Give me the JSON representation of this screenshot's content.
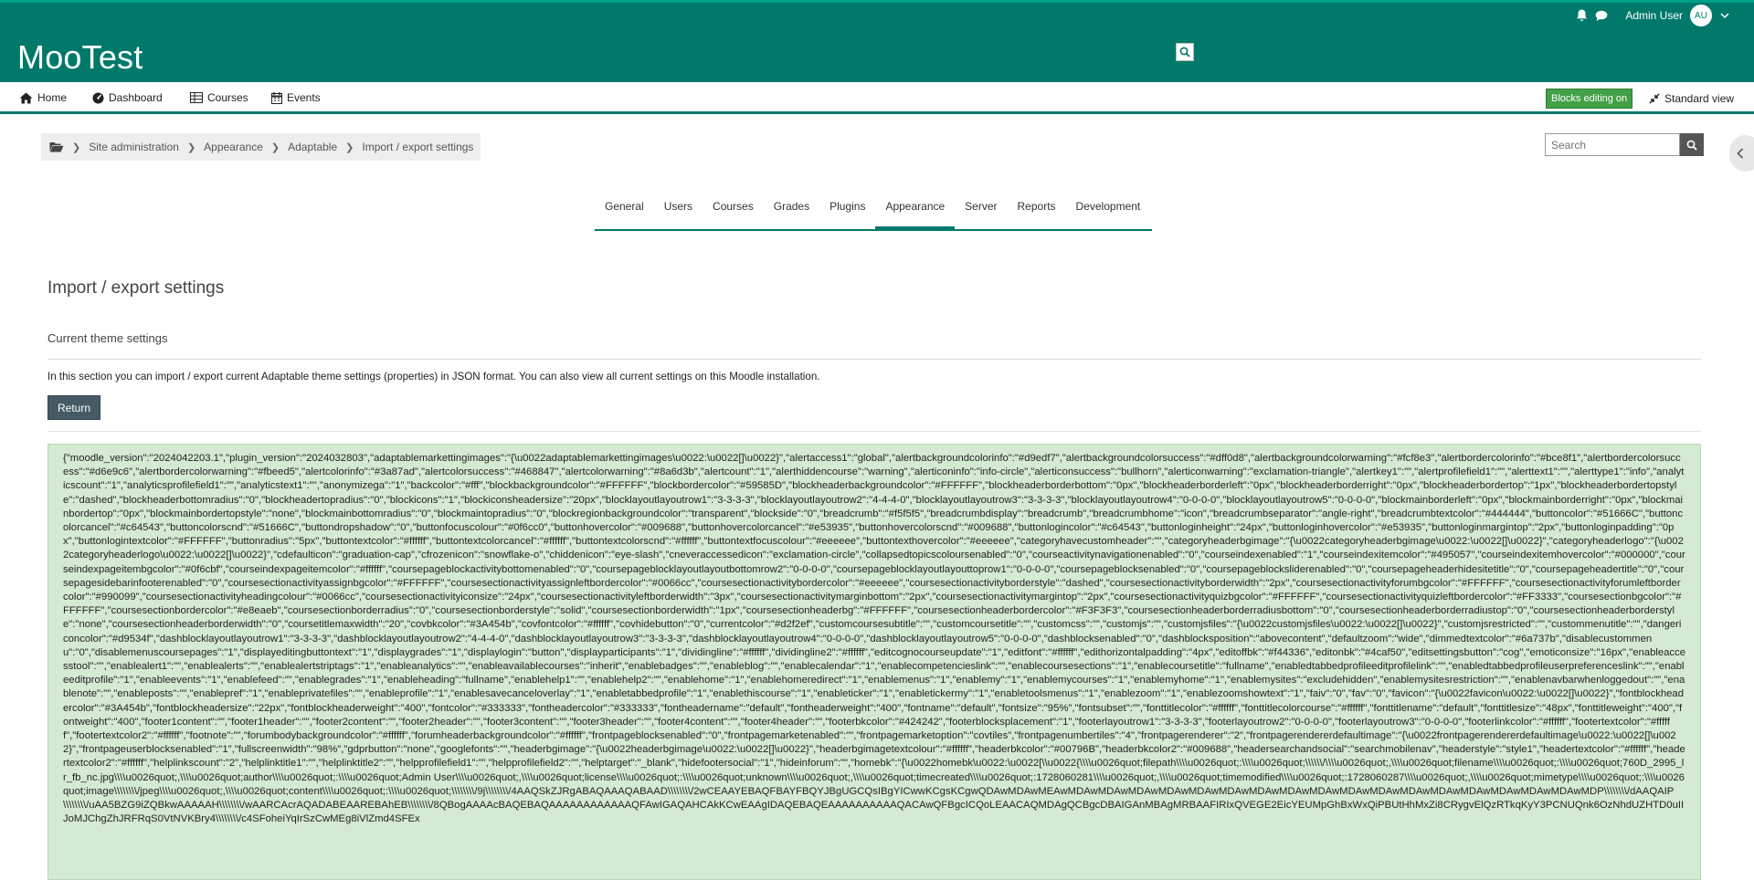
{
  "header": {
    "site_name": "MooTest",
    "user_name": "Admin User",
    "user_initials": "AU",
    "accent_color": "#00796b"
  },
  "nav": {
    "items": [
      {
        "label": "Home",
        "icon": "home-icon"
      },
      {
        "label": "Dashboard",
        "icon": "dashboard-icon"
      },
      {
        "label": "Courses",
        "icon": "table-icon"
      },
      {
        "label": "Events",
        "icon": "calendar-icon"
      }
    ],
    "blocks_editing_label": "Blocks editing on",
    "standard_view_label": "Standard view"
  },
  "breadcrumb": {
    "items": [
      "Site administration",
      "Appearance",
      "Adaptable",
      "Import / export settings"
    ]
  },
  "search": {
    "placeholder": "Search"
  },
  "tabs": [
    "General",
    "Users",
    "Courses",
    "Grades",
    "Plugins",
    "Appearance",
    "Server",
    "Reports",
    "Development"
  ],
  "active_tab": "Appearance",
  "main": {
    "title": "Import / export settings",
    "section_title": "Current theme settings",
    "intro": "In this section you can import / export current Adaptable theme settings (properties) in JSON format. You can also view all current settings on this Moodle installation.",
    "return_label": "Return",
    "json_text": "{\"moodle_version\":\"2024042203.1\",\"plugin_version\":\"2024032803\",\"adaptablemarkettingimages\":\"{\\u0022adaptablemarkettingimages\\u0022:\\u0022[]\\u0022}\",\"alertaccess1\":\"global\",\"alertbackgroundcolorinfo\":\"#d9edf7\",\"alertbackgroundcolorsuccess\":\"#dff0d8\",\"alertbackgroundcolorwarning\":\"#fcf8e3\",\"alertbordercolorinfo\":\"#bce8f1\",\"alertbordercolorsuccess\":\"#d6e9c6\",\"alertbordercolorwarning\":\"#fbeed5\",\"alertcolorinfo\":\"#3a87ad\",\"alertcolorsuccess\":\"#468847\",\"alertcolorwarning\":\"#8a6d3b\",\"alertcount\":\"1\",\"alerthiddencourse\":\"warning\",\"alerticoninfo\":\"info-circle\",\"alerticonsuccess\":\"bullhorn\",\"alerticonwarning\":\"exclamation-triangle\",\"alertkey1\":\"\",\"alertprofilefield1\":\"\",\"alerttext1\":\"\",\"alerttype1\":\"info\",\"analyticscount\":\"1\",\"analyticsprofilefield1\":\"\",\"analyticstext1\":\"\",\"anonymizega\":\"1\",\"backcolor\":\"#fff\",\"blockbackgroundcolor\":\"#FFFFFF\",\"blockbordercolor\":\"#59585D\",\"blockheaderbackgroundcolor\":\"#FFFFFF\",\"blockheaderborderbottom\":\"0px\",\"blockheaderborderleft\":\"0px\",\"blockheaderborderright\":\"0px\",\"blockheaderbordertop\":\"1px\",\"blockheaderbordertopstyle\":\"dashed\",\"blockheaderbottomradius\":\"0\",\"blockheadertopradius\":\"0\",\"blockicons\":\"1\",\"blockiconsheadersize\":\"20px\",\"blocklayoutlayoutrow1\":\"3-3-3-3\",\"blocklayoutlayoutrow2\":\"4-4-4-0\",\"blocklayoutlayoutrow3\":\"3-3-3-3\",\"blocklayoutlayoutrow4\":\"0-0-0-0\",\"blocklayoutlayoutrow5\":\"0-0-0-0\",\"blockmainborderleft\":\"0px\",\"blockmainborderright\":\"0px\",\"blockmainbordertop\":\"0px\",\"blockmainbordertopstyle\":\"none\",\"blockmainbottomradius\":\"0\",\"blockmaintopradius\":\"0\",\"blockregionbackgroundcolor\":\"transparent\",\"blockside\":\"0\",\"breadcrumb\":\"#f5f5f5\",\"breadcrumbdisplay\":\"breadcrumb\",\"breadcrumbhome\":\"icon\",\"breadcrumbseparator\":\"angle-right\",\"breadcrumbtextcolor\":\"#444444\",\"buttoncolor\":\"#51666C\",\"buttoncolorcancel\":\"#c64543\",\"buttoncolorscnd\":\"#51666C\",\"buttondropshadow\":\"0\",\"buttonfocuscolour\":\"#0f6cc0\",\"buttonhovercolor\":\"#009688\",\"buttonhovercolorcancel\":\"#e53935\",\"buttonhovercolorscnd\":\"#009688\",\"buttonlogincolor\":\"#c64543\",\"buttonloginheight\":\"24px\",\"buttonloginhovercolor\":\"#e53935\",\"buttonloginmargintop\":\"2px\",\"buttonloginpadding\":\"0px\",\"buttonlogintextcolor\":\"#FFFFFF\",\"buttonradius\":\"5px\",\"buttontextcolor\":\"#ffffff\",\"buttontextcolorcancel\":\"#ffffff\",\"buttontextcolorscnd\":\"#ffffff\",\"buttontextfocuscolour\":\"#eeeeee\",\"buttontexthovercolor\":\"#eeeeee\",\"categoryhavecustomheader\":\"\",\"categoryheaderbgimage\":\"{\\u0022categoryheaderbgimage\\u0022:\\u0022[]\\u0022}\",\"categoryheaderlogo\":\"{\\u0022categoryheaderlogo\\u0022:\\u0022[]\\u0022}\",\"cdefaulticon\":\"graduation-cap\",\"cfrozenicon\":\"snowflake-o\",\"chiddenicon\":\"eye-slash\",\"cneveraccessedicon\":\"exclamation-circle\",\"collapsedtopicscoloursenabled\":\"0\",\"courseactivitynavigationenabled\":\"0\",\"courseindexenabled\":\"1\",\"courseindexitemcolor\":\"#495057\",\"courseindexitemhovercolor\":\"#000000\",\"courseindexpageitembgcolor\":\"#0f6cbf\",\"courseindexpageitemcolor\":\"#ffffff\",\"coursepageblockactivitybottomenabled\":\"0\",\"coursepageblocklayoutlayoutbottomrow2\":\"0-0-0-0\",\"coursepageblocklayoutlayouttoprow1\":\"0-0-0-0\",\"coursepageblocksenabled\":\"0\",\"coursepageblocksliderenabled\":\"0\",\"coursepageheaderhidesitetitle\":\"0\",\"coursepageheadertitle\":\"0\",\"coursepagesidebarinfooterenabled\":\"0\",\"coursesectionactivityassignbgcolor\":\"#FFFFFF\",\"coursesectionactivityassignleftbordercolor\":\"#0066cc\",\"coursesectionactivitybordercolor\":\"#eeeeee\",\"coursesectionactivityborderstyle\":\"dashed\",\"coursesectionactivityborderwidth\":\"2px\",\"coursesectionactivityforumbgcolor\":\"#FFFFFF\",\"coursesectionactivityforumleftbordercolor\":\"#990099\",\"coursesectionactivityheadingcolour\":\"#0066cc\",\"coursesectionactivityiconsize\":\"24px\",\"coursesectionactivityleftborderwidth\":\"3px\",\"coursesectionactivitymarginbottom\":\"2px\",\"coursesectionactivitymargintop\":\"2px\",\"coursesectionactivityquizbgcolor\":\"#FFFFFF\",\"coursesectionactivityquizleftbordercolor\":\"#FF3333\",\"coursesectionbgcolor\":\"#FFFFFF\",\"coursesectionbordercolor\":\"#e8eaeb\",\"coursesectionborderradius\":\"0\",\"coursesectionborderstyle\":\"solid\",\"coursesectionborderwidth\":\"1px\",\"coursesectionheaderbg\":\"#FFFFFF\",\"coursesectionheaderbordercolor\":\"#F3F3F3\",\"coursesectionheaderborderradiusbottom\":\"0\",\"coursesectionheaderborderradiustop\":\"0\",\"coursesectionheaderborderstyle\":\"none\",\"coursesectionheaderborderwidth\":\"0\",\"coursetitlemaxwidth\":\"20\",\"covbkcolor\":\"#3A454b\",\"covfontcolor\":\"#ffffff\",\"covhidebutton\":\"0\",\"currentcolor\":\"#d2f2ef\",\"customcoursesubtitle\":\"\",\"customcoursetitle\":\"\",\"customcss\":\"\",\"customjs\":\"\",\"customjsfiles\":\"{\\u0022customjsfiles\\u0022:\\u0022[]\\u0022}\",\"customjsrestricted\":\"\",\"custommenutitle\":\"\",\"dangericoncolor\":\"#d9534f\",\"dashblocklayoutlayoutrow1\":\"3-3-3-3\",\"dashblocklayoutlayoutrow2\":\"4-4-4-0\",\"dashblocklayoutlayoutrow3\":\"3-3-3-3\",\"dashblocklayoutlayoutrow4\":\"0-0-0-0\",\"dashblocklayoutlayoutrow5\":\"0-0-0-0\",\"dashblocksenabled\":\"0\",\"dashblocksposition\":\"abovecontent\",\"defaultzoom\":\"wide\",\"dimmedtextcolor\":\"#6a737b\",\"disablecustommenu\":\"0\",\"disablemenuscoursepages\":\"1\",\"displayeditingbuttontext\":\"1\",\"displaygrades\":\"1\",\"displaylogin\":\"button\",\"displayparticipants\":\"1\",\"dividingline\":\"#ffffff\",\"dividingline2\":\"#ffffff\",\"editcognocourseupdate\":\"1\",\"editfont\":\"#ffffff\",\"edithorizontalpadding\":\"4px\",\"editoffbk\":\"#f44336\",\"editonbk\":\"#4caf50\",\"editsettingsbutton\":\"cog\",\"emoticonsize\":\"16px\",\"enableaccesstool\":\"\",\"enablealert1\":\"\",\"enablealerts\":\"\",\"enablealertstriptags\":\"1\",\"enableanalytics\":\"\",\"enableavailablecourses\":\"inherit\",\"enablebadges\":\"\",\"enableblog\":\"\",\"enablecalendar\":\"1\",\"enablecompetencieslink\":\"\",\"enablecoursesections\":\"1\",\"enablecoursetitle\":\"fullname\",\"enabledtabbedprofileeditprofilelink\":\"\",\"enabledtabbedprofileuserpreferenceslink\":\"\",\"enableeditprofile\":\"1\",\"enableevents\":\"1\",\"enablefeed\":\"\",\"enablegrades\":\"1\",\"enableheading\":\"fullname\",\"enablehelp1\":\"\",\"enablehelp2\":\"\",\"enablehome\":\"1\",\"enablehomeredirect\":\"1\",\"enablemenus\":\"1\",\"enablemy\":\"1\",\"enablemycourses\":\"1\",\"enablemyhome\":\"1\",\"enablemysites\":\"excludehidden\",\"enablemysitesrestriction\":\"\",\"enablenavbarwhenloggedout\":\"\",\"enablenote\":\"\",\"enableposts\":\"\",\"enablepref\":\"1\",\"enableprivatefiles\":\"\",\"enableprofile\":\"1\",\"enablesavecanceloverlay\":\"1\",\"enabletabbedprofile\":\"1\",\"enablethiscourse\":\"1\",\"enableticker\":\"1\",\"enabletickermy\":\"1\",\"enabletoolsmenus\":\"1\",\"enablezoom\":\"1\",\"enablezoomshowtext\":\"1\",\"faiv\":\"0\",\"fav\":\"0\",\"favicon\":\"{\\u0022favicon\\u0022:\\u0022[]\\u0022}\",\"fontblockheadercolor\":\"#3A454b\",\"fontblockheadersize\":\"22px\",\"fontblockheaderweight\":\"400\",\"fontcolor\":\"#333333\",\"fontheadercolor\":\"#333333\",\"fontheadername\":\"default\",\"fontheaderweight\":\"400\",\"fontname\":\"default\",\"fontsize\":\"95%\",\"fontsubset\":\"\",\"fonttitlecolor\":\"#ffffff\",\"fonttitlecolorcourse\":\"#ffffff\",\"fonttitlename\":\"default\",\"fonttitlesize\":\"48px\",\"fonttitleweight\":\"400\",\"fontweight\":\"400\",\"footer1content\":\"\",\"footer1header\":\"\",\"footer2content\":\"\",\"footer2header\":\"\",\"footer3content\":\"\",\"footer3header\":\"\",\"footer4content\":\"\",\"footer4header\":\"\",\"footerbkcolor\":\"#424242\",\"footerblocksplacement\":\"1\",\"footerlayoutrow1\":\"3-3-3-3\",\"footerlayoutrow2\":\"0-0-0-0\",\"footerlayoutrow3\":\"0-0-0-0\",\"footerlinkcolor\":\"#ffffff\",\"footertextcolor\":\"#ffffff\",\"footertextcolor2\":\"#ffffff\",\"footnote\":\"\",\"forumbodybackgroundcolor\":\"#ffffff\",\"forumheaderbackgroundcolor\":\"#ffffff\",\"frontpageblocksenabled\":\"0\",\"frontpagemarketenabled\":\"\",\"frontpagemarketoption\":\"covtiles\",\"frontpagenumbertiles\":\"4\",\"frontpagerenderer\":\"2\",\"frontpagerendererdefaultimage\":\"{\\u0022frontpagerendererdefaultimage\\u0022:\\u0022[]\\u0022}\",\"frontpageuserblocksenabled\":\"1\",\"fullscreenwidth\":\"98%\",\"gdprbutton\":\"none\",\"googlefonts\":\"\",\"headerbgimage\":\"{\\u0022headerbgimage\\u0022:\\u0022[]\\u0022}\",\"headerbgimagetextcolour\":\"#ffffff\",\"headerbkcolor\":\"#00796B\",\"headerbkcolor2\":\"#009688\",\"headersearchandsocial\":\"searchmobilenav\",\"headerstyle\":\"style1\",\"headertextcolor\":\"#ffffff\",\"headertextcolor2\":\"#ffffff\",\"helplinkscount\":\"2\",\"helplinktitle1\":\"\",\"helplinktitle2\":\"\",\"helpprofilefield1\":\"\",\"helpprofilefield2\":\"\",\"helptarget\":\"_blank\",\"hidefootersocial\":\"1\",\"hideinforum\":\"\",\"homebk\":\"{\\u0022homebk\\u0022:\\u0022[\\\\u0022{\\\\\\\\u0026quot;filepath\\\\\\\\u0026quot;:\\\\\\\\u0026quot;\\\\\\\\\\\\/\\\\\\\\u0026quot;,\\\\\\\\u0026quot;filename\\\\\\\\u0026quot;:\\\\\\\\u0026quot;760D_2995_lr_fb_nc.jpg\\\\\\\\u0026quot;,\\\\\\\\u0026quot;author\\\\\\\\u0026quot;:\\\\\\\\u0026quot;Admin User\\\\\\\\u0026quot;,\\\\\\\\u0026quot;license\\\\\\\\u0026quot;:\\\\\\\\u0026quot;unknown\\\\\\\\u0026quot;,\\\\\\\\u0026quot;timecreated\\\\\\\\u0026quot;:1728060281\\\\\\\\u0026quot;,\\\\\\\\u0026quot;timemodified\\\\\\\\u0026quot;:1728060287\\\\\\\\u0026quot;,\\\\\\\\u0026quot;mimetype\\\\\\\\u0026quot;:\\\\\\\\u0026quot;image\\\\\\\\\\\\\\\\/jpeg\\\\\\\\u0026quot;,\\\\\\\\u0026quot;content\\\\\\\\u0026quot;:\\\\\\\\u0026quot;\\\\\\\\\\\\\\\\/9j\\\\\\\\\\\\\\\\/4AAQSkZJRgABAQAAAQABAAD\\\\\\\\\\\\\\\\/2wCEAAYEBAQFBAYFBQYJBgUGCQsIBgYICwwKCgsKCgwQDAwMDAwMEAwMDAwMDAwMDAwMDAwMDAwMDAwMDAwMDAwMDAwMDAwMDAwMDAwMDAwMDAwMDAwMDAwMDAwMDP\\\\\\\\\\\\\\\\/dAAQAIP\\\\\\\\\\\\\\\\/uAA5BZG9iZQBkwAAAAAH\\\\\\\\\\\\\\\\/wAARCAcrAQADABEAAREBAhEB\\\\\\\\\\\\\\\\/8QBogAAAAcBAQEBAQAAAAAAAAAAAAQFAwIGAQAHCAkKCwEAAgIDAQEBAQEAAAAAAAAAAQACAwQFBgcICQoLEAACAQMDAgQCBgcDBAIGAnMBAgMRBAAFIRIxQVEGE2EicYEUMpGhBxWxQiPBUtHhMxZi8CRygvElQzRTkqKyY3PCNUQnk6OzNhdUZHTD0uIIJoMJChgZhJRFRqS0VtNVKBry4\\\\\\\\\\\\\\\\/c4SFoheiYqIrSzCwMEg8iVlZmd4SFEx"
  }
}
